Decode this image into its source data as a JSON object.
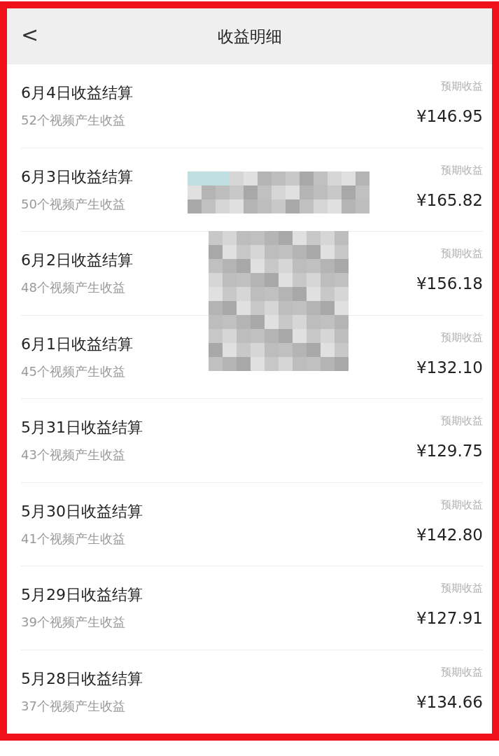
{
  "header": {
    "back": "<",
    "title": "收益明细"
  },
  "rows": [
    {
      "title": "6月4日收益结算",
      "subtitle": "52个视频产生收益",
      "label": "预期收益",
      "amount": "¥146.95"
    },
    {
      "title": "6月3日收益结算",
      "subtitle": "50个视频产生收益",
      "label": "预期收益",
      "amount": "¥165.82"
    },
    {
      "title": "6月2日收益结算",
      "subtitle": "48个视频产生收益",
      "label": "预期收益",
      "amount": "¥156.18"
    },
    {
      "title": "6月1日收益结算",
      "subtitle": "45个视频产生收益",
      "label": "预期收益",
      "amount": "¥132.10"
    },
    {
      "title": "5月31日收益结算",
      "subtitle": "43个视频产生收益",
      "label": "预期收益",
      "amount": "¥129.75"
    },
    {
      "title": "5月30日收益结算",
      "subtitle": "41个视频产生收益",
      "label": "预期收益",
      "amount": "¥142.80"
    },
    {
      "title": "5月29日收益结算",
      "subtitle": "39个视频产生收益",
      "label": "预期收益",
      "amount": "¥127.91"
    },
    {
      "title": "5月28日收益结算",
      "subtitle": "37个视频产生收益",
      "label": "预期收益",
      "amount": "¥134.66"
    }
  ]
}
